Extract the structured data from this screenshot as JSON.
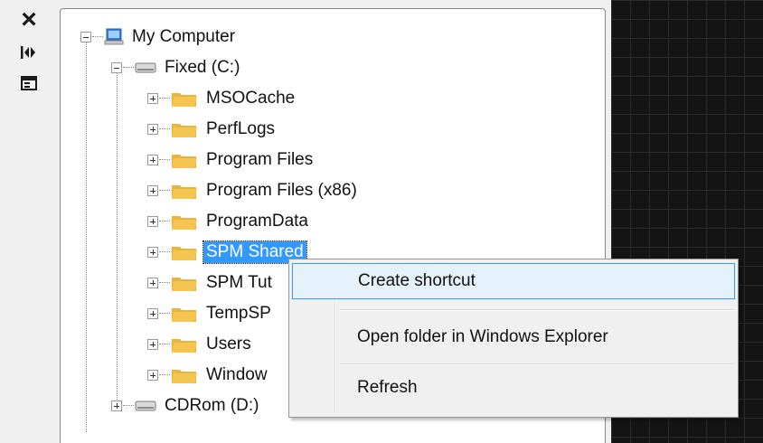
{
  "toolbar": {
    "close_icon": "close-icon",
    "expand_icon": "expand-collapse-icon",
    "panel_icon": "panel-layout-icon"
  },
  "tree": {
    "root": {
      "label": "My Computer",
      "expanded": true,
      "icon": "computer-icon"
    },
    "drives": [
      {
        "label": "Fixed (C:)",
        "expanded": true,
        "icon": "drive-icon",
        "folders": [
          {
            "label": "MSOCache",
            "selected": false
          },
          {
            "label": "PerfLogs",
            "selected": false
          },
          {
            "label": "Program Files",
            "selected": false
          },
          {
            "label": "Program Files (x86)",
            "selected": false
          },
          {
            "label": "ProgramData",
            "selected": false
          },
          {
            "label": "SPM Shared",
            "selected": true
          },
          {
            "label": "SPM Tut",
            "selected": false
          },
          {
            "label": "TempSP",
            "selected": false
          },
          {
            "label": "Users",
            "selected": false
          },
          {
            "label": "Window",
            "selected": false
          }
        ]
      },
      {
        "label": "CDRom (D:)",
        "expanded": false,
        "icon": "cdrom-drive-icon"
      }
    ]
  },
  "context_menu": {
    "items": [
      {
        "label": "Create shortcut",
        "highlighted": true
      },
      {
        "label": "Open folder in Windows Explorer",
        "highlighted": false
      },
      {
        "label": "Refresh",
        "highlighted": false
      }
    ]
  },
  "colors": {
    "selection": "#3399ff",
    "menu_highlight_border": "#3399ff",
    "menu_highlight_fill": "#e5f1fb",
    "canvas_background": "#141414",
    "folder": "#f5c451"
  }
}
